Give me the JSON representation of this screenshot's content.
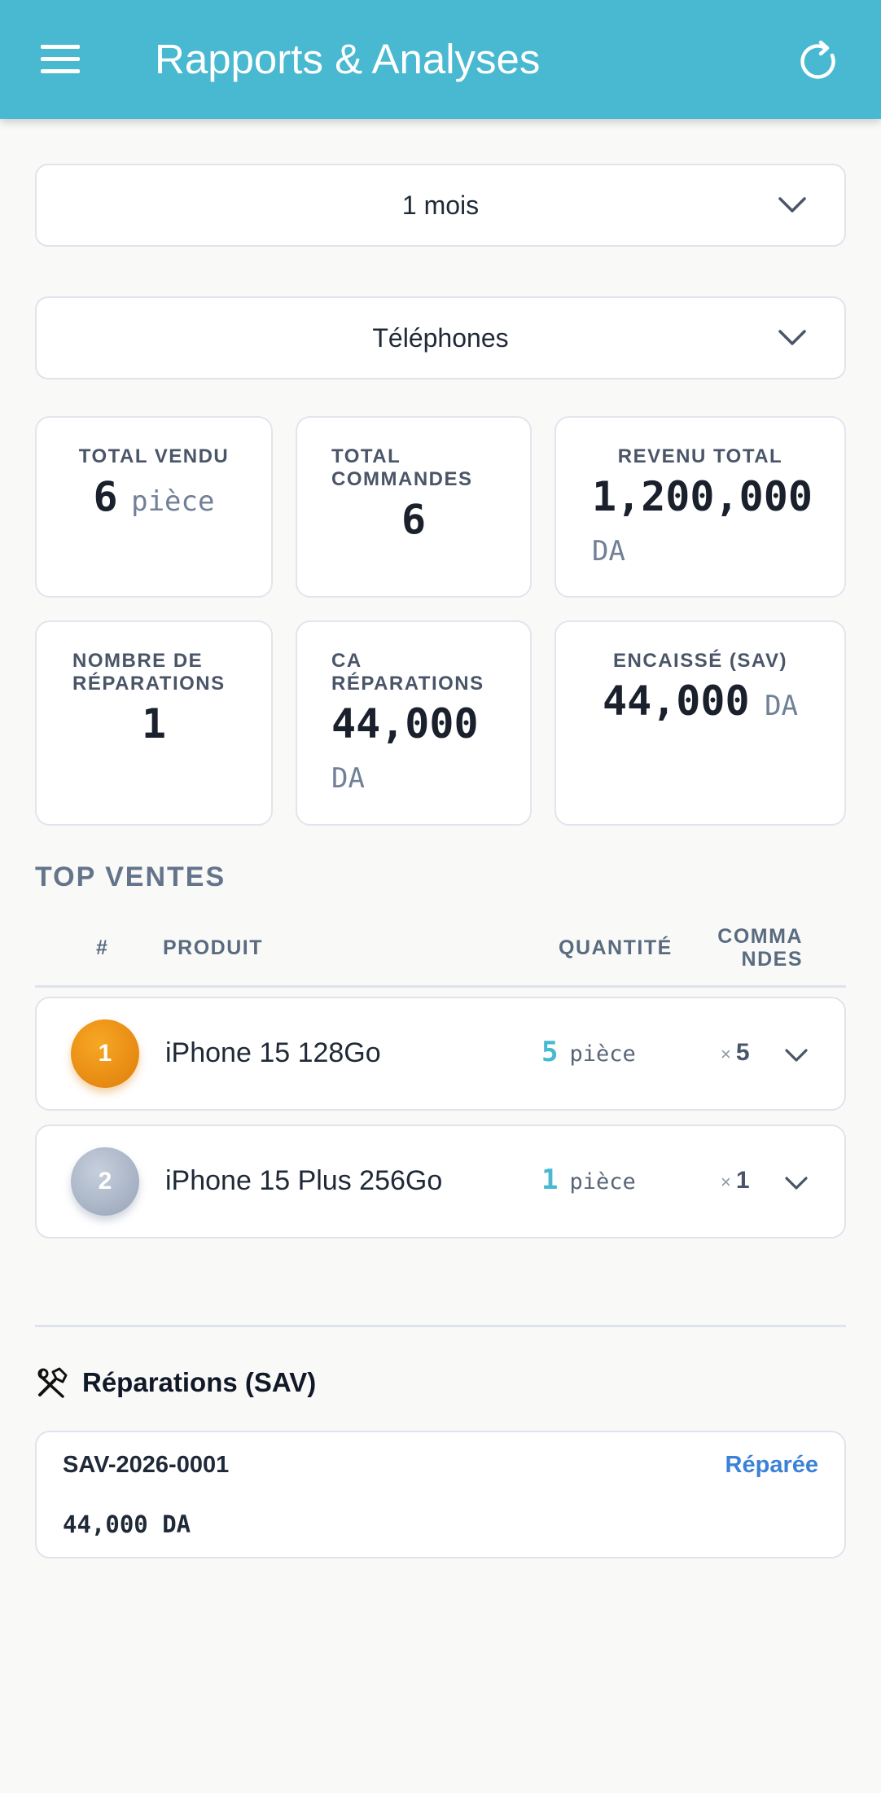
{
  "app": {
    "title": "Rapports & Analyses",
    "menu_icon": "menu-icon",
    "refresh_icon": "refresh-icon"
  },
  "filters": {
    "period": "1 mois",
    "category": "Téléphones"
  },
  "stats": [
    {
      "label": "TOTAL VENDU",
      "value": "6",
      "unit": "pièce"
    },
    {
      "label_line1": "TOTAL",
      "label_line2": "COMMANDES",
      "value": "6"
    },
    {
      "label": "REVENU TOTAL",
      "value": "1,200,000",
      "unit": "DA"
    },
    {
      "label_line1": "NOMBRE DE",
      "label_line2": "RÉPARATIONS",
      "value": "1"
    },
    {
      "label_line1": "CA",
      "label_line2": "RÉPARATIONS",
      "value": "44,000",
      "unit": "DA"
    },
    {
      "label": "ENCAISSÉ (SAV)",
      "value": "44,000",
      "unit": "DA"
    }
  ],
  "top_sales": {
    "title": "TOP VENTES",
    "headers": {
      "rank": "#",
      "product": "PRODUIT",
      "quantity": "QUANTITÉ",
      "orders_line1": "COMMA",
      "orders_line2": "NDES"
    },
    "rows": [
      {
        "rank": "1",
        "product": "iPhone 15 128Go",
        "qty": "5",
        "unit": "pièce",
        "times": "×",
        "orders": "5"
      },
      {
        "rank": "2",
        "product": "iPhone 15 Plus 256Go",
        "qty": "1",
        "unit": "pièce",
        "times": "×",
        "orders": "1"
      }
    ]
  },
  "repairs": {
    "title": "Réparations (SAV)",
    "items": [
      {
        "id": "SAV-2026-0001",
        "status": "Réparée",
        "amount": "44,000 DA"
      }
    ]
  },
  "colors": {
    "appbar": "#49b8d1",
    "accent": "#49b8d1",
    "status": "#3b82d6",
    "gold": "#f29a17",
    "silver": "#aab5c6"
  }
}
